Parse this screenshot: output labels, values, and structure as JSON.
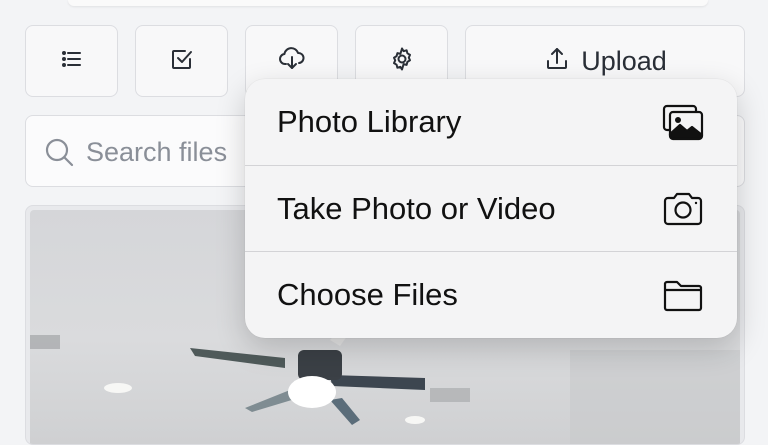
{
  "toolbar": {
    "list_icon": "list-icon",
    "select_icon": "checkbox-icon",
    "download_icon": "cloud-download-icon",
    "settings_icon": "gear-icon",
    "upload_icon": "upload-icon",
    "upload_label": "Upload"
  },
  "search": {
    "icon": "search-icon",
    "placeholder": "Search files"
  },
  "preview": {
    "image": "ceiling-fan-room-photo"
  },
  "upload_menu": {
    "items": [
      {
        "label": "Photo Library",
        "icon": "photo-library-icon"
      },
      {
        "label": "Take Photo or Video",
        "icon": "camera-icon"
      },
      {
        "label": "Choose Files",
        "icon": "folder-icon"
      }
    ]
  }
}
